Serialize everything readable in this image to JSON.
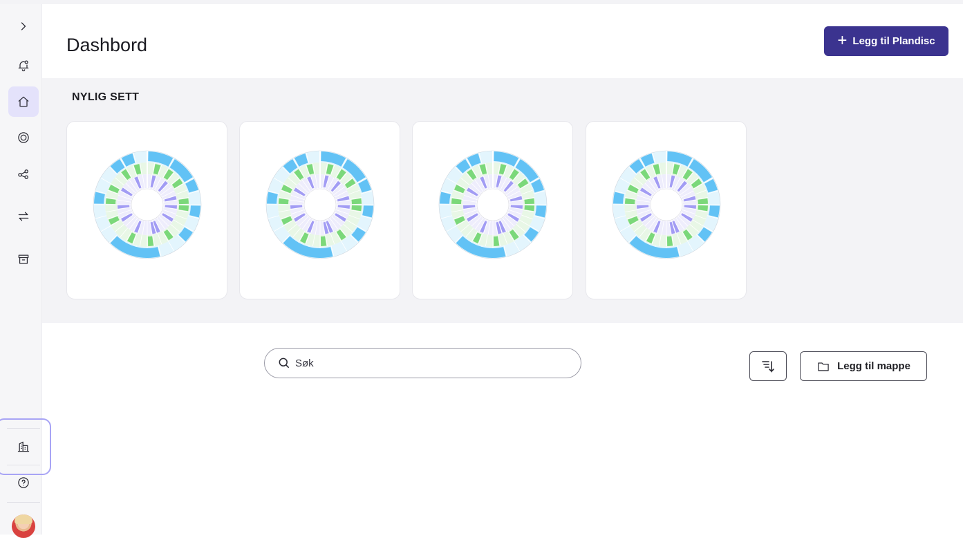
{
  "header": {
    "title": "Dashbord",
    "add_plandisc_label": "Legg til Plandisc",
    "accent": "#3b338f"
  },
  "sidebar": {
    "items": [
      {
        "name": "expand",
        "icon": "chevron-right-icon"
      },
      {
        "name": "notifications",
        "icon": "bell-icon"
      },
      {
        "name": "home",
        "icon": "home-icon",
        "active": true
      },
      {
        "name": "goals",
        "icon": "target-icon"
      },
      {
        "name": "share",
        "icon": "share-icon"
      },
      {
        "name": "transfer",
        "icon": "arrows-swap-icon"
      },
      {
        "name": "archive",
        "icon": "archive-icon"
      },
      {
        "name": "organization",
        "icon": "building-icon",
        "highlighted": true
      },
      {
        "name": "help",
        "icon": "help-circle-icon"
      },
      {
        "name": "profile",
        "icon": "avatar"
      }
    ],
    "active_color": "#e4e2fb"
  },
  "recent": {
    "title": "NYLIG SETT",
    "cards": [
      {
        "icon": "plandisc-wheel"
      },
      {
        "icon": "plandisc-wheel"
      },
      {
        "icon": "plandisc-wheel"
      },
      {
        "icon": "plandisc-wheel"
      }
    ],
    "ring_colors": {
      "outer": "#62c2f5",
      "outer_bg": "#e3f5fd",
      "middle": "#7bd87a",
      "middle_bg": "#e8f7e6",
      "inner": "#a29cf4",
      "inner_bg": "#eeedfc"
    }
  },
  "toolbar": {
    "search_placeholder": "Søk",
    "sort_icon": "sort-descending-icon",
    "add_folder_label": "Legg til mappe",
    "folder_icon": "folder-icon"
  }
}
